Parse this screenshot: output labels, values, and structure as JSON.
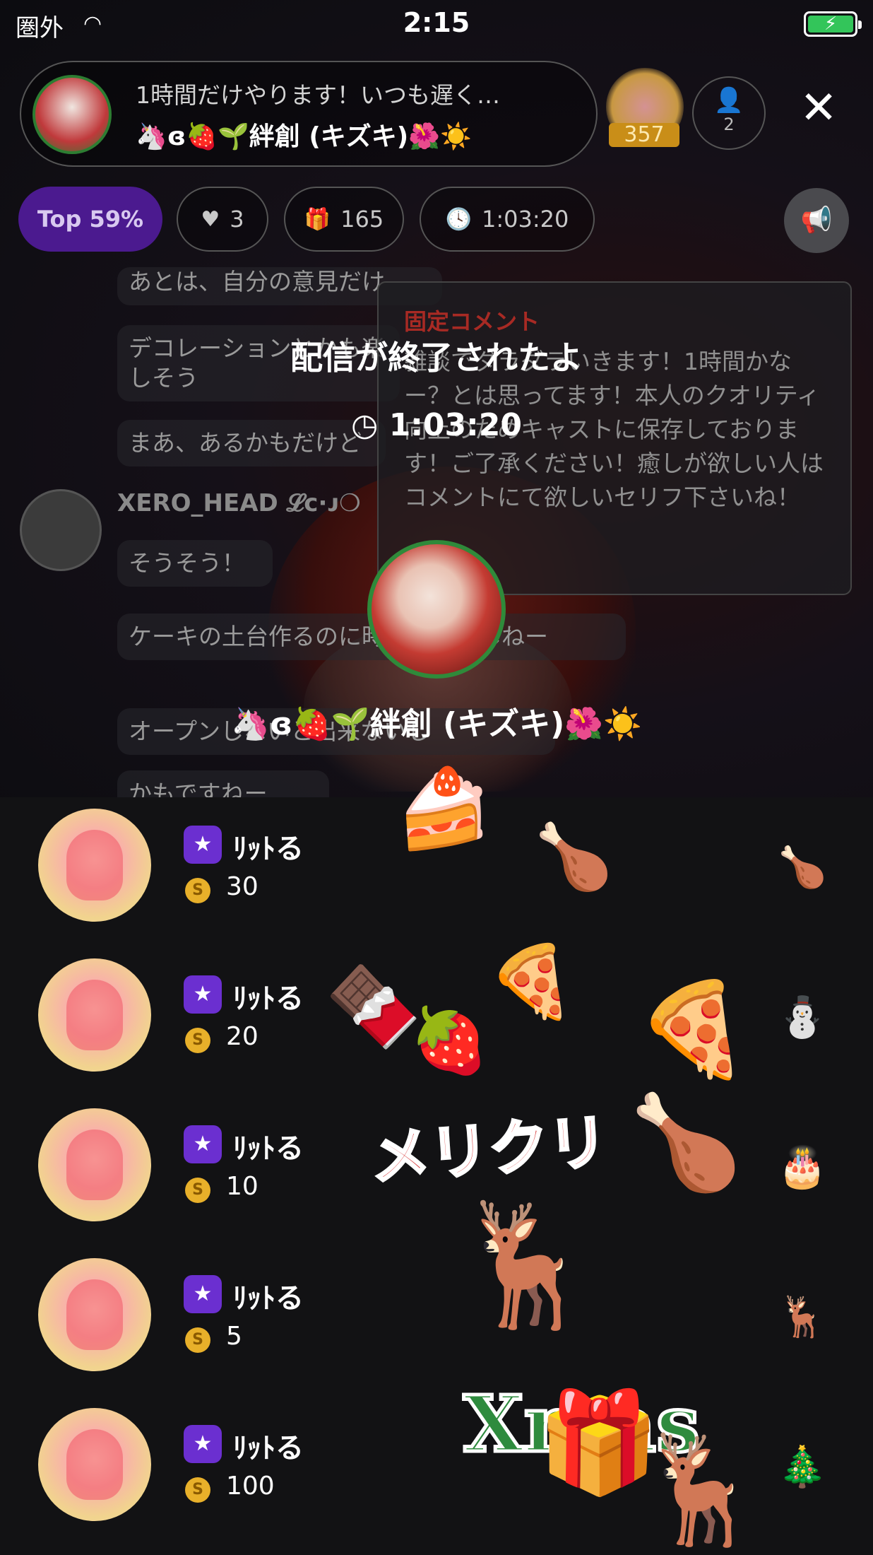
{
  "status_bar": {
    "carrier": "圏外",
    "time": "2:15",
    "battery_icon": "charging-battery-icon"
  },
  "host": {
    "title": "1時間だけやります！いつも遅く…",
    "name": "🦄ɞ🍓🌱絆創 (キズキ)🌺☀️",
    "rank_count": "357",
    "viewer_count": "2"
  },
  "stats": {
    "top_label": "Top 59%",
    "likes": "3",
    "gifts": "165",
    "duration": "1:03:20"
  },
  "chat": {
    "messages": [
      "あとは、自分の意見だけ",
      "デコレーションとかも楽しそう",
      "まあ、あるかもだけど",
      "そうそう！",
      "ケーキの土台作るのに時間かかるしねー",
      "オープンしないと出来ないし",
      "かもですねー"
    ],
    "username": "XERO_HEAD 𝓛ᴄ·ᴊ❍"
  },
  "pinned": {
    "title": "固定コメント",
    "text": "雑談でダラダラいきます！1時間かなー？とは思ってます！本人のクオリティ向上のためキャストに保存しております！ご了承ください！癒しが欲しい人はコメントにて欲しいセリフ下さいね！"
  },
  "ended": {
    "title": "配信が終了されたよ",
    "duration": "1:03:20",
    "host_name": "🦄ɞ🍓🌱絆創 (キズキ)🌺☀️"
  },
  "gift_list": [
    {
      "user": "ﾘｯﾄる",
      "amount": "30",
      "gift_icon": "roast-chicken-icon",
      "gift_glyph": "🍗"
    },
    {
      "user": "ﾘｯﾄる",
      "amount": "20",
      "gift_icon": "snowman-icon",
      "gift_glyph": "⛄"
    },
    {
      "user": "ﾘｯﾄる",
      "amount": "10",
      "gift_icon": "christmas-cake-icon",
      "gift_glyph": "🎂"
    },
    {
      "user": "ﾘｯﾄる",
      "amount": "5",
      "gift_icon": "reindeer-merikuri-icon",
      "gift_glyph": "🦌"
    },
    {
      "user": "ﾘｯﾄる",
      "amount": "100",
      "gift_icon": "wreath-icon",
      "gift_glyph": "🎄"
    }
  ],
  "overlay_text": {
    "merikuri": "メリクリ",
    "xmas_x": "X",
    "xmas_mas": "mas"
  }
}
